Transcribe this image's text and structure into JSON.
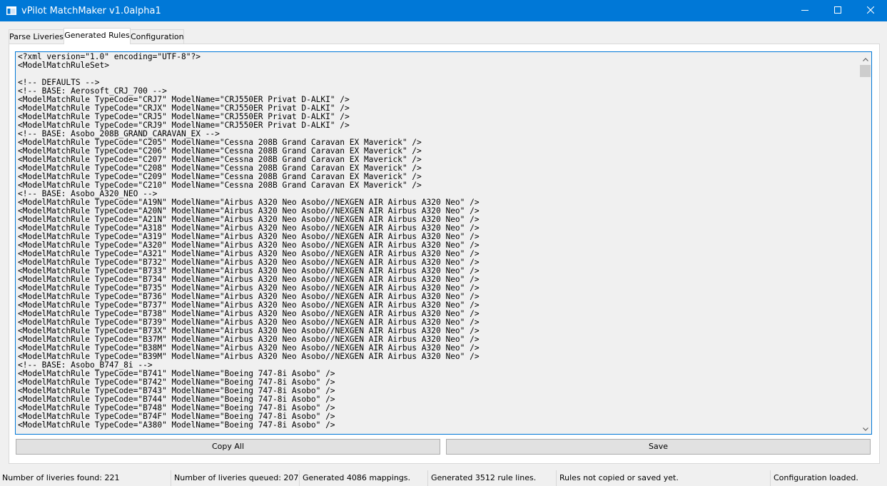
{
  "window": {
    "title": "vPilot MatchMaker v1.0alpha1",
    "titlebar_color": "#0078d7",
    "icons": {
      "app": "app-window-icon",
      "minimize": "minimize-icon",
      "maximize": "maximize-icon",
      "close": "close-icon"
    }
  },
  "tabs": [
    {
      "label": "Parse Liveries",
      "active": false
    },
    {
      "label": "Generated Rules",
      "active": true
    },
    {
      "label": "Configuration",
      "active": false
    }
  ],
  "editor": {
    "lines": [
      "<?xml version=\"1.0\" encoding=\"UTF-8\"?>",
      "<ModelMatchRuleSet>",
      "",
      "<!-- DEFAULTS -->",
      "<!-- BASE: Aerosoft_CRJ_700 -->",
      "<ModelMatchRule TypeCode=\"CRJ7\" ModelName=\"CRJ550ER Privat D-ALKI\" />",
      "<ModelMatchRule TypeCode=\"CRJX\" ModelName=\"CRJ550ER Privat D-ALKI\" />",
      "<ModelMatchRule TypeCode=\"CRJ5\" ModelName=\"CRJ550ER Privat D-ALKI\" />",
      "<ModelMatchRule TypeCode=\"CRJ9\" ModelName=\"CRJ550ER Privat D-ALKI\" />",
      "<!-- BASE: Asobo_208B_GRAND_CARAVAN_EX -->",
      "<ModelMatchRule TypeCode=\"C205\" ModelName=\"Cessna 208B Grand Caravan EX Maverick\" />",
      "<ModelMatchRule TypeCode=\"C206\" ModelName=\"Cessna 208B Grand Caravan EX Maverick\" />",
      "<ModelMatchRule TypeCode=\"C207\" ModelName=\"Cessna 208B Grand Caravan EX Maverick\" />",
      "<ModelMatchRule TypeCode=\"C208\" ModelName=\"Cessna 208B Grand Caravan EX Maverick\" />",
      "<ModelMatchRule TypeCode=\"C209\" ModelName=\"Cessna 208B Grand Caravan EX Maverick\" />",
      "<ModelMatchRule TypeCode=\"C210\" ModelName=\"Cessna 208B Grand Caravan EX Maverick\" />",
      "<!-- BASE: Asobo_A320_NEO -->",
      "<ModelMatchRule TypeCode=\"A19N\" ModelName=\"Airbus A320 Neo Asobo//NEXGEN AIR Airbus A320 Neo\" />",
      "<ModelMatchRule TypeCode=\"A20N\" ModelName=\"Airbus A320 Neo Asobo//NEXGEN AIR Airbus A320 Neo\" />",
      "<ModelMatchRule TypeCode=\"A21N\" ModelName=\"Airbus A320 Neo Asobo//NEXGEN AIR Airbus A320 Neo\" />",
      "<ModelMatchRule TypeCode=\"A318\" ModelName=\"Airbus A320 Neo Asobo//NEXGEN AIR Airbus A320 Neo\" />",
      "<ModelMatchRule TypeCode=\"A319\" ModelName=\"Airbus A320 Neo Asobo//NEXGEN AIR Airbus A320 Neo\" />",
      "<ModelMatchRule TypeCode=\"A320\" ModelName=\"Airbus A320 Neo Asobo//NEXGEN AIR Airbus A320 Neo\" />",
      "<ModelMatchRule TypeCode=\"A321\" ModelName=\"Airbus A320 Neo Asobo//NEXGEN AIR Airbus A320 Neo\" />",
      "<ModelMatchRule TypeCode=\"B732\" ModelName=\"Airbus A320 Neo Asobo//NEXGEN AIR Airbus A320 Neo\" />",
      "<ModelMatchRule TypeCode=\"B733\" ModelName=\"Airbus A320 Neo Asobo//NEXGEN AIR Airbus A320 Neo\" />",
      "<ModelMatchRule TypeCode=\"B734\" ModelName=\"Airbus A320 Neo Asobo//NEXGEN AIR Airbus A320 Neo\" />",
      "<ModelMatchRule TypeCode=\"B735\" ModelName=\"Airbus A320 Neo Asobo//NEXGEN AIR Airbus A320 Neo\" />",
      "<ModelMatchRule TypeCode=\"B736\" ModelName=\"Airbus A320 Neo Asobo//NEXGEN AIR Airbus A320 Neo\" />",
      "<ModelMatchRule TypeCode=\"B737\" ModelName=\"Airbus A320 Neo Asobo//NEXGEN AIR Airbus A320 Neo\" />",
      "<ModelMatchRule TypeCode=\"B738\" ModelName=\"Airbus A320 Neo Asobo//NEXGEN AIR Airbus A320 Neo\" />",
      "<ModelMatchRule TypeCode=\"B739\" ModelName=\"Airbus A320 Neo Asobo//NEXGEN AIR Airbus A320 Neo\" />",
      "<ModelMatchRule TypeCode=\"B73X\" ModelName=\"Airbus A320 Neo Asobo//NEXGEN AIR Airbus A320 Neo\" />",
      "<ModelMatchRule TypeCode=\"B37M\" ModelName=\"Airbus A320 Neo Asobo//NEXGEN AIR Airbus A320 Neo\" />",
      "<ModelMatchRule TypeCode=\"B38M\" ModelName=\"Airbus A320 Neo Asobo//NEXGEN AIR Airbus A320 Neo\" />",
      "<ModelMatchRule TypeCode=\"B39M\" ModelName=\"Airbus A320 Neo Asobo//NEXGEN AIR Airbus A320 Neo\" />",
      "<!-- BASE: Asobo_B747_8i -->",
      "<ModelMatchRule TypeCode=\"B741\" ModelName=\"Boeing 747-8i Asobo\" />",
      "<ModelMatchRule TypeCode=\"B742\" ModelName=\"Boeing 747-8i Asobo\" />",
      "<ModelMatchRule TypeCode=\"B743\" ModelName=\"Boeing 747-8i Asobo\" />",
      "<ModelMatchRule TypeCode=\"B744\" ModelName=\"Boeing 747-8i Asobo\" />",
      "<ModelMatchRule TypeCode=\"B748\" ModelName=\"Boeing 747-8i Asobo\" />",
      "<ModelMatchRule TypeCode=\"B74F\" ModelName=\"Boeing 747-8i Asobo\" />",
      "<ModelMatchRule TypeCode=\"A380\" ModelName=\"Boeing 747-8i Asobo\" />"
    ]
  },
  "scrollbar": {
    "up_icon": "scroll-up-icon",
    "down_icon": "scroll-down-icon"
  },
  "buttons": {
    "copy_all": "Copy All",
    "save": "Save"
  },
  "status": {
    "liveries_found": "Number of liveries found: 221",
    "liveries_queued": "Number of liveries queued: 207",
    "mappings": "Generated 4086 mappings.",
    "rule_lines": "Generated 3512 rule lines.",
    "save_state": "Rules not copied or saved yet.",
    "config_state": "Configuration loaded."
  }
}
